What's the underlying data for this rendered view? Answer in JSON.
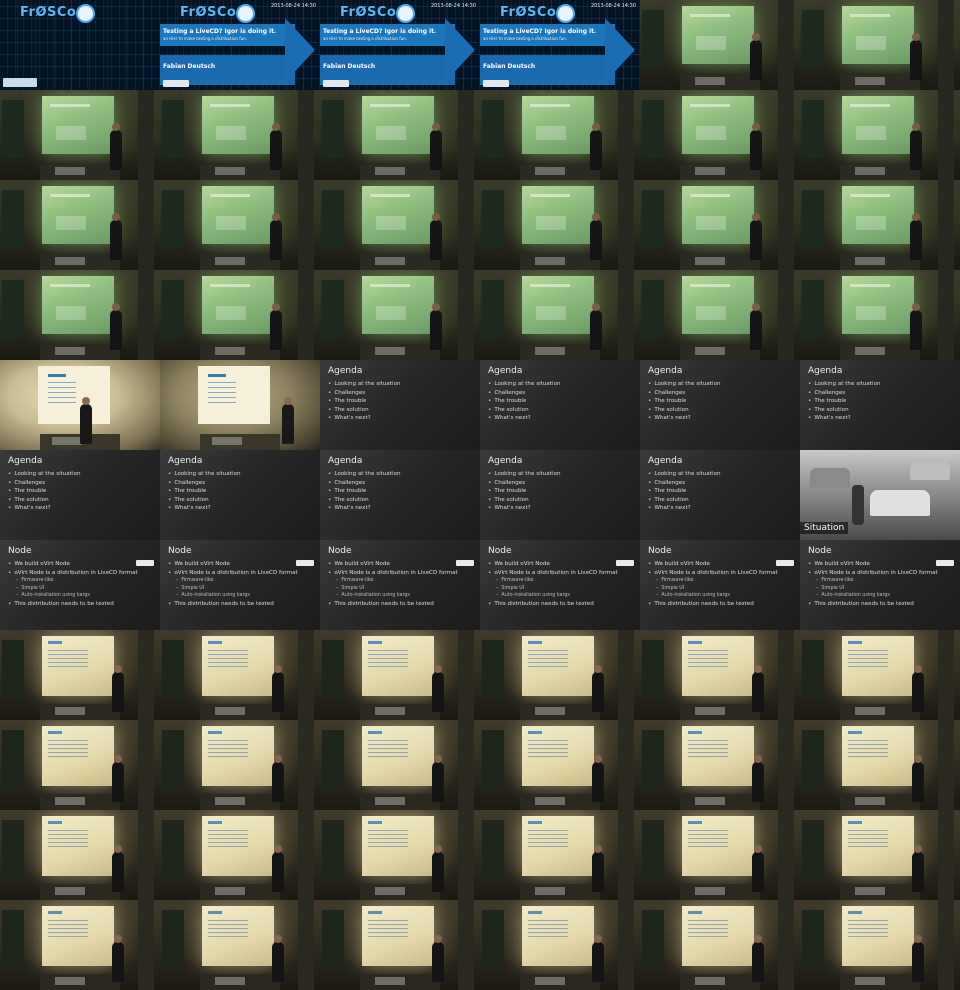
{
  "title_slide": {
    "logo": "FrØSCon",
    "date": "2013-08-24 14:30",
    "title": "Testing a LiveCD? Igor is doing it.",
    "subtitle": "an Hier to make testing a distribution fun.",
    "author": "Fabian Deutsch"
  },
  "agenda_slide": {
    "heading": "Agenda",
    "items": [
      "Looking at the situation",
      "Challenges",
      "The trouble",
      "The solution",
      "What's next?"
    ]
  },
  "situation_slide": {
    "label": "Situation"
  },
  "node_slide": {
    "heading": "Node",
    "items": [
      {
        "text": "We build oVirt Node",
        "level": 1
      },
      {
        "text": "oVirt Node is a distribution in LiveCD format",
        "level": 1
      },
      {
        "text": "Firmware-like",
        "level": 2
      },
      {
        "text": "Simple UI",
        "level": 2
      },
      {
        "text": "Auto-installation using kargs",
        "level": 2
      },
      {
        "text": "This distribution needs to be tested",
        "level": 1
      }
    ]
  },
  "tiles": [
    "title_first",
    "title",
    "title",
    "title",
    "green",
    "green",
    "green",
    "green",
    "green",
    "green",
    "green",
    "green",
    "green",
    "green",
    "green",
    "green",
    "green",
    "green",
    "green",
    "green",
    "green",
    "green",
    "green",
    "green",
    "bright",
    "bright_dim",
    "agenda",
    "agenda",
    "agenda",
    "agenda",
    "agenda",
    "agenda",
    "agenda",
    "agenda",
    "agenda",
    "situation",
    "node",
    "node",
    "node",
    "node",
    "node",
    "node",
    "warm",
    "warm",
    "warm",
    "warm",
    "warm",
    "warm",
    "warm",
    "warm",
    "warm",
    "warm",
    "warm",
    "warm",
    "warm",
    "warm",
    "warm",
    "warm",
    "warm",
    "warm",
    "warm",
    "warm",
    "warm",
    "warm",
    "warm",
    "warm"
  ]
}
